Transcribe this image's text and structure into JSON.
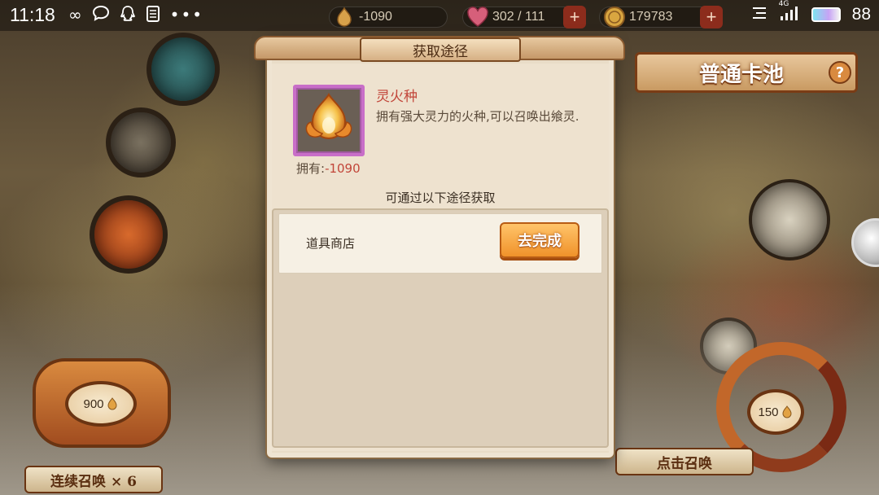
{
  "status_bar": {
    "time": "11:18",
    "icons": [
      "infinity-icon",
      "chat-bubble-icon",
      "qq-icon",
      "document-icon",
      "more-icon"
    ],
    "network": "4G",
    "battery": "88"
  },
  "resources": {
    "flame_seed": "-1090",
    "stamina": "302 / 111",
    "coins": "179783"
  },
  "card_pool": {
    "title": "普通卡池",
    "help": "?"
  },
  "summon_multi": {
    "cost": "900",
    "label": "连续召唤 × 6"
  },
  "summon_single": {
    "cost": "150",
    "label": "点击召唤"
  },
  "dialog": {
    "title": "获取途径",
    "item": {
      "name": "灵火种",
      "description": "拥有强大灵力的火种,可以召唤出飨灵.",
      "own_label": "拥有:",
      "own_value": "-1090"
    },
    "route_header": "可通过以下途径获取",
    "routes": [
      {
        "source": "道具商店",
        "action": "去完成"
      }
    ]
  },
  "colors": {
    "accent_orange": "#f0922a",
    "item_name_red": "#c2463a",
    "rarity_purple": "#c86ec8"
  }
}
